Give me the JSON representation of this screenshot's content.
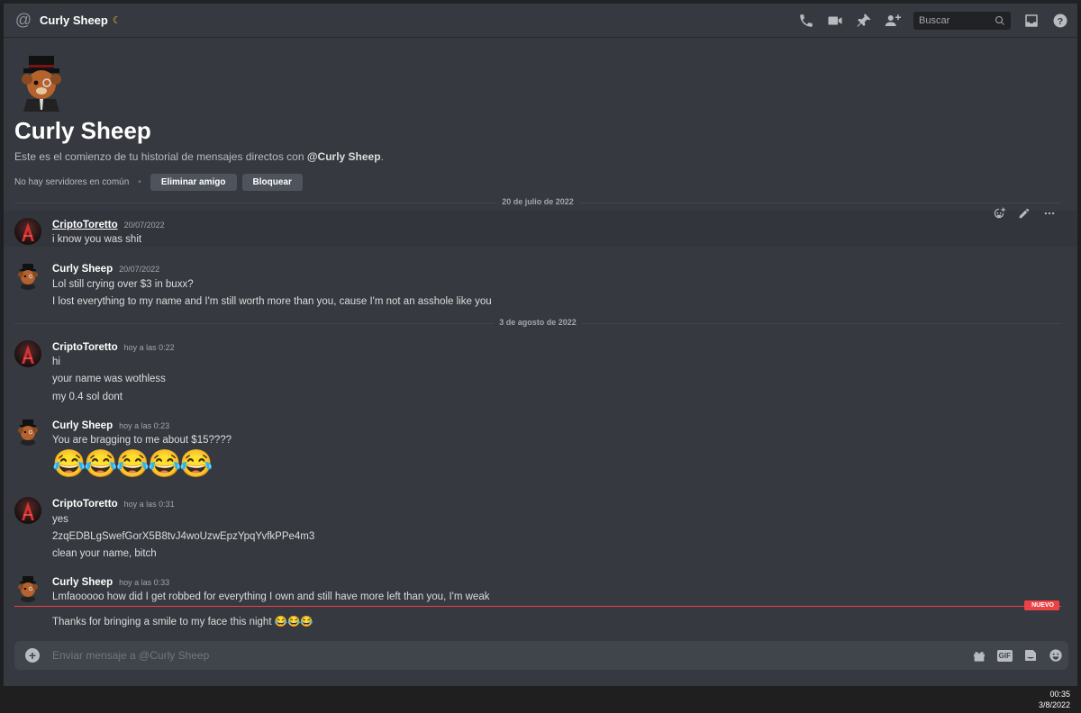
{
  "header": {
    "channel_name": "Curly Sheep",
    "search_placeholder": "Buscar",
    "icons": [
      "at-icon",
      "call-icon",
      "video-icon",
      "pin-icon",
      "add-friend-icon",
      "search-icon",
      "inbox-icon",
      "help-icon"
    ]
  },
  "intro": {
    "title": "Curly Sheep",
    "subtitle_prefix": "Este es el comienzo de tu historial de mensajes directos con ",
    "subtitle_user": "@Curly Sheep",
    "subtitle_suffix": ".",
    "no_servers": "No hay servidores en común",
    "dot": "•",
    "remove_friend": "Eliminar amigo",
    "block": "Bloquear"
  },
  "dividers": {
    "d1": "20 de julio de 2022",
    "d2": "3 de agosto de 2022"
  },
  "messages": [
    {
      "author": "CriptoToretto",
      "time": "20/07/2022",
      "lines": [
        "i know you was shit"
      ]
    },
    {
      "author": "Curly Sheep",
      "time": "20/07/2022",
      "lines": [
        "Lol still crying over $3 in buxx?",
        "I lost everything to my name and I'm still worth more than you, cause I'm not an asshole like you"
      ]
    },
    {
      "author": "CriptoToretto",
      "time": "hoy a las 0:22",
      "lines": [
        "hi",
        "your name was wothless",
        "my 0.4 sol dont"
      ]
    },
    {
      "author": "Curly Sheep",
      "time": "hoy a las 0:23",
      "lines": [
        "You are bragging to me about $15????",
        "😂😂😂😂😂"
      ]
    },
    {
      "author": "CriptoToretto",
      "time": "hoy a las 0:31",
      "lines": [
        "yes",
        "2zqEDBLgSwefGorX5B8tvJ4woUzwEpzYpqYvfkPPe4m3",
        "clean your name, bitch"
      ]
    },
    {
      "author": "Curly Sheep",
      "time": "hoy a las 0:33",
      "lines": [
        "Lmfaooooo how did I get robbed for everything I own and still have more left than you, I'm weak",
        "Thanks for bringing a smile to my face this night 😂😂😂"
      ]
    }
  ],
  "new_badge": "NUEVO",
  "composer": {
    "placeholder": "Enviar mensaje a @Curly Sheep",
    "gif_label": "GIF"
  },
  "taskbar": {
    "time": "00:35",
    "date": "3/8/2022"
  },
  "colors": {
    "background": "#36393f",
    "accent_red": "#ed4245",
    "moon": "#f0b232"
  }
}
